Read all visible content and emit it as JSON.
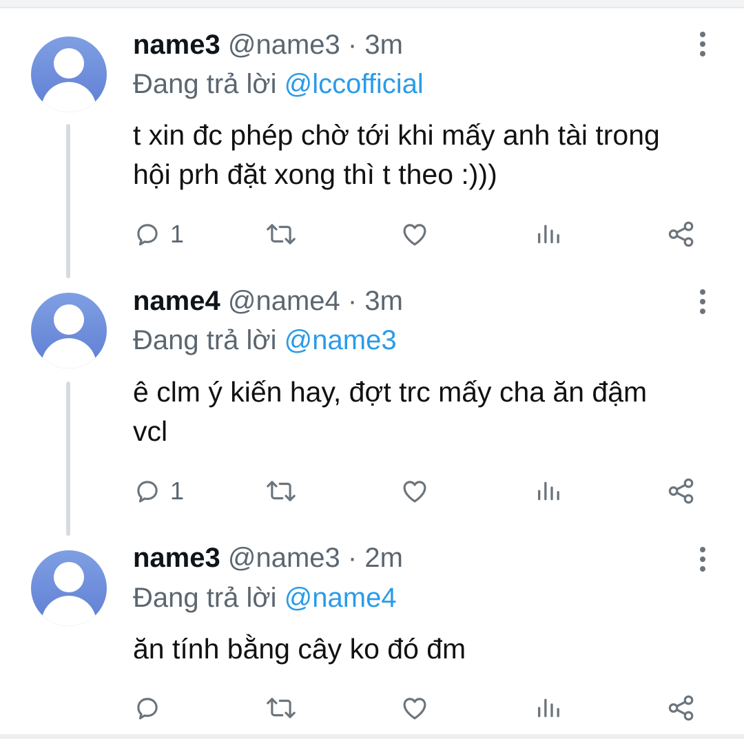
{
  "tweets": [
    {
      "name": "name3",
      "handle": "@name3",
      "dot": "·",
      "time": "3m",
      "reply_prefix": "Đang trả lời",
      "reply_to": "@lccofficial",
      "text": "t xin đc phép chờ tới khi mấy anh tài trong hội prh đặt xong thì t theo :)))",
      "reply_count": "1"
    },
    {
      "name": "name4",
      "handle": "@name4",
      "dot": "·",
      "time": "3m",
      "reply_prefix": "Đang trả lời",
      "reply_to": "@name3",
      "text": "ê clm ý kiến hay, đợt trc mấy cha ăn đậm vcl",
      "reply_count": "1"
    },
    {
      "name": "name3",
      "handle": "@name3",
      "dot": "·",
      "time": "2m",
      "reply_prefix": "Đang trả lời",
      "reply_to": "@name4",
      "text": "ăn tính bằng cây ko đó đm",
      "reply_count": ""
    }
  ],
  "icons": {
    "avatar": "default-avatar-icon",
    "reply": "reply-icon",
    "retweet": "retweet-icon",
    "like": "heart-icon",
    "analytics": "analytics-icon",
    "share": "share-icon",
    "more": "more-vertical-icon"
  },
  "colors": {
    "mention": "#2a9be8",
    "avatar": "#6f8edb",
    "icon": "#6b747c",
    "thread_line": "#d7dbe0"
  }
}
